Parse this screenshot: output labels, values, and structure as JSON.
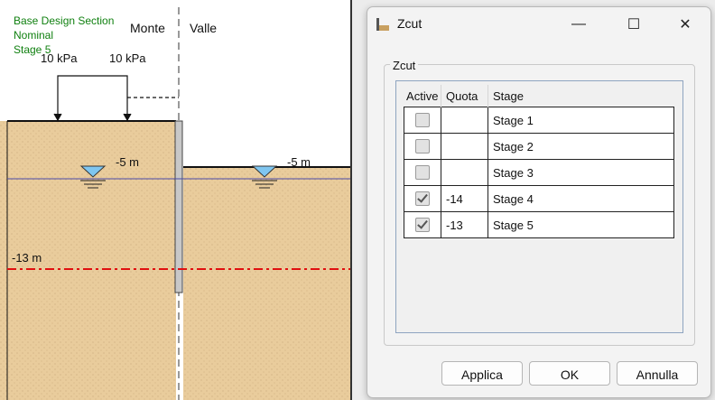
{
  "drawing": {
    "info_lines": [
      "Base Design Section",
      "Nominal",
      "Stage 5"
    ],
    "side_left": "Monte",
    "side_right": "Valle",
    "load_left": "10 kPa",
    "load_right": "10 kPa",
    "water_left": "-5 m",
    "water_right": "-5 m",
    "cut_level": "-13 m"
  },
  "dialog": {
    "title": "Zcut",
    "minimize": "—",
    "maximize": "☐",
    "close": "✕",
    "group_label": "Zcut",
    "columns": [
      "Active",
      "Quota",
      "Stage"
    ],
    "rows": [
      {
        "active": false,
        "quota": "",
        "stage": "Stage 1"
      },
      {
        "active": false,
        "quota": "",
        "stage": "Stage 2"
      },
      {
        "active": false,
        "quota": "",
        "stage": "Stage 3"
      },
      {
        "active": true,
        "quota": "-14",
        "stage": "Stage 4"
      },
      {
        "active": true,
        "quota": "-13",
        "stage": "Stage 5"
      }
    ],
    "buttons": {
      "apply": "Applica",
      "ok": "OK",
      "cancel": "Annulla"
    }
  }
}
